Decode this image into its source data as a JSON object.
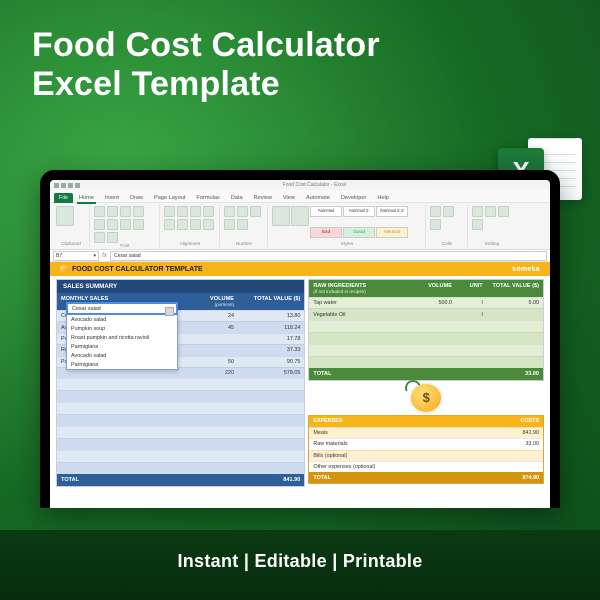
{
  "hero": {
    "line1": "Food Cost Calculator",
    "line2": "Excel Template",
    "excel_badge": "X"
  },
  "footer": {
    "text": "Instant | Editable | Printable"
  },
  "titlebar": {
    "doc": "Food Cost Calculator - Excel"
  },
  "tabs": {
    "file": "File",
    "items": [
      "Home",
      "Insert",
      "Draw",
      "Page Layout",
      "Formulas",
      "Data",
      "Review",
      "View",
      "Automate",
      "Developer",
      "Help"
    ],
    "active": "Home"
  },
  "ribbon": {
    "groups": [
      "Clipboard",
      "Font",
      "Alignment",
      "Number",
      "Styles",
      "Cells",
      "Editing"
    ],
    "styles": {
      "r1": [
        "Normal",
        "Normal 2",
        "Normal 2 2"
      ],
      "r2": [
        "Bad",
        "Good",
        "Neutral"
      ]
    }
  },
  "fx": {
    "namebox": "B7",
    "value": "Cesar salad",
    "fx_label": "fx"
  },
  "ws": {
    "header_title": "FOOD COST CALCULATOR TEMPLATE",
    "brand": "someka"
  },
  "sales": {
    "title": "SALES SUMMARY",
    "col1": "MONTHLY SALES",
    "col2": "VOLUME",
    "col2_sub": "(portions)",
    "col3": "TOTAL VALUE ($)",
    "rows": [
      {
        "name": "Cesar salad",
        "vol": "24",
        "val": "13.80"
      },
      {
        "name": "Avocado salad",
        "vol": "45",
        "val": "118.24"
      },
      {
        "name": "Pumpkin soup",
        "vol": "",
        "val": "17.78"
      },
      {
        "name": "Roast pumpkin and ricotta ravioli",
        "vol": "",
        "val": "37.33"
      },
      {
        "name": "Parmigiana",
        "vol": "50",
        "val": "90.75"
      },
      {
        "name": "",
        "vol": "220",
        "val": "578.05"
      }
    ],
    "total_label": "TOTAL",
    "total_value": "841.90"
  },
  "dropdown": {
    "selected": "Cesar salad",
    "options": [
      "Avocado salad",
      "Pumpkin soup",
      "Roast pumpkin and ricotta ravioli",
      "Parmigiana",
      "Avocado salad",
      "Parmigiana"
    ]
  },
  "raw": {
    "title": "RAW INGREDIENTS",
    "subtitle": "(if not included in recipes)",
    "col2": "VOLUME",
    "col3": "UNIT",
    "col4": "TOTAL VALUE ($)",
    "rows": [
      {
        "name": "Tap water",
        "vol": "500.0",
        "unit": "l",
        "val": "5.00"
      },
      {
        "name": "Vegetable Oil",
        "vol": "",
        "unit": "l",
        "val": ""
      }
    ],
    "total_label": "TOTAL",
    "total_value": "33.00"
  },
  "expenses": {
    "head1": "EXPENSES",
    "head2": "COSTS",
    "rows": [
      {
        "name": "Meals",
        "val": "841.90"
      },
      {
        "name": "Raw materials",
        "val": "33.00"
      },
      {
        "name": "Bills (optional)",
        "val": ""
      },
      {
        "name": "Other expenses (optional)",
        "val": ""
      }
    ],
    "total_label": "TOTAL",
    "total_value": "874.90"
  }
}
